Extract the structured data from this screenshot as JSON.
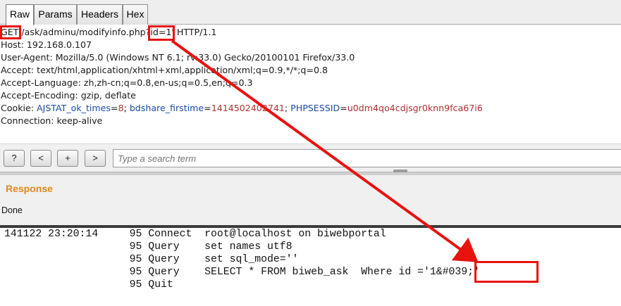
{
  "tabs": [
    {
      "label": "Raw",
      "active": true
    },
    {
      "label": "Params",
      "active": false
    },
    {
      "label": "Headers",
      "active": false
    },
    {
      "label": "Hex",
      "active": false
    }
  ],
  "request": {
    "method": "GET",
    "path": " /ask/adminu/modifyinfo.php?",
    "param": "id=1'",
    "protocol": " HTTP/1.1",
    "host": "Host: 192.168.0.107",
    "user_agent": "User-Agent: Mozilla/5.0 (Windows NT 6.1; rv:33.0) Gecko/20100101 Firefox/33.0",
    "accept": "Accept: text/html,application/xhtml+xml,application/xml;q=0.9,*/*;q=0.8",
    "accept_language": "Accept-Language: zh,zh-cn;q=0.8,en-us;q=0.5,en;q=0.3",
    "accept_encoding": "Accept-Encoding: gzip, deflate",
    "cookie_label": "Cookie: ",
    "cookie_parts": [
      {
        "key": "AJSTAT_ok_times",
        "value": "8",
        "sep": "; "
      },
      {
        "key": "bdshare_firstime",
        "value": "1414502402741",
        "sep": "; "
      },
      {
        "key": "PHPSESSID",
        "value": "u0dm4qo4cdjsgr0knn9fca67i6",
        "sep": ""
      }
    ],
    "connection": "Connection: keep-alive"
  },
  "search": {
    "help_label": "?",
    "prev_label": "<",
    "add_label": "+",
    "next_label": ">",
    "placeholder": "Type a search term"
  },
  "response": {
    "title": "Response",
    "status": "Done"
  },
  "log_lines": [
    "141122 23:20:14\t    95 Connect\troot@localhost on biwebportal",
    "\t\t    95 Query\tset names utf8",
    "\t\t    95 Query\tset sql_mode=''",
    "\t\t    95 Query\tSELECT * FROM biweb_ask  Where id ='1&#039;'",
    "\t\t    95 Quit"
  ],
  "colors": {
    "annotation": "#e8120f",
    "response_title": "#e1881f",
    "cookie_key": "#1c4aa8",
    "cookie_value": "#b13030"
  }
}
